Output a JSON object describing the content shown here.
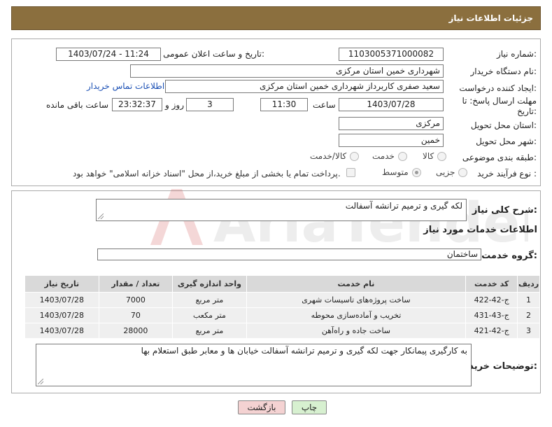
{
  "header": {
    "title": "جزئیات اطلاعات نیاز"
  },
  "info": {
    "need_number_label": "شماره نیاز:",
    "need_number": "1103005371000082",
    "announce_label": "تاریخ و ساعت اعلان عمومی:",
    "announce_value": "1403/07/24 - 11:24",
    "buyer_org_label": "نام دستگاه خریدار:",
    "buyer_org": "شهرداری خمین استان مرکزی",
    "requester_label": "ایجاد کننده درخواست:",
    "requester": "سعید صفری کاربرداز شهرداری خمین استان مرکزی",
    "contact_link": "اطلاعات تماس خریدار",
    "deadline_label": "مهلت ارسال پاسخ: تا تاریخ:",
    "deadline_date": "1403/07/28",
    "time_label": "ساعت",
    "deadline_time": "11:30",
    "days_value": "3",
    "days_label": "روز و",
    "remaining_time": "23:32:37",
    "remaining_label": "ساعت باقی مانده",
    "province_label": "استان محل تحویل:",
    "province": "مرکزی",
    "city_label": "شهر محل تحویل:",
    "city": "خمین",
    "category_label": "طبقه بندی موضوعی:",
    "category_options": [
      "کالا",
      "خدمت",
      "کالا/خدمت"
    ],
    "purchase_type_label": "نوع فرآیند خرید :",
    "purchase_options": [
      "جزیی",
      "متوسط"
    ],
    "payment_note": "پرداخت تمام یا بخشی از مبلغ خرید،از محل \"اسناد خزانه اسلامی\" خواهد بود."
  },
  "details": {
    "summary_label": "شرح کلی نیاز:",
    "summary": "لکه گیری و ترمیم ترانشه آسفالت",
    "services_heading": "اطلاعات خدمات مورد نیاز",
    "service_group_label": "گروه خدمت:",
    "service_group": "ساختمان",
    "table_headers": [
      "ردیف",
      "کد خدمت",
      "نام خدمت",
      "واحد اندازه گیری",
      "تعداد / مقدار",
      "تاریخ نیاز"
    ],
    "rows": [
      [
        "1",
        "ج-42-422",
        "ساخت پروژه‌های تاسیسات شهری",
        "متر مربع",
        "7000",
        "1403/07/28"
      ],
      [
        "2",
        "ج-43-431",
        "تخریب و آماده‌سازی محوطه",
        "متر مکعب",
        "70",
        "1403/07/28"
      ],
      [
        "3",
        "ج-42-421",
        "ساخت جاده و راه‌آهن",
        "متر مربع",
        "28000",
        "1403/07/28"
      ]
    ],
    "buyer_notes_label": "توضیحات خریدار:",
    "buyer_notes": "به کارگیری پیمانکار جهت لکه گیری و ترمیم ترانشه آسفالت خیابان ها و معابر طبق استعلام بها"
  },
  "buttons": {
    "print": "چاپ",
    "back": "بازگشت"
  },
  "watermark": {
    "text": "AriaTender.neT"
  }
}
